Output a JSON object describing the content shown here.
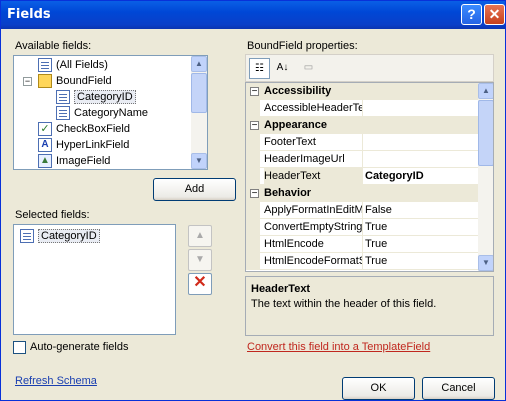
{
  "window": {
    "title": "Fields",
    "help_glyph": "?",
    "close_glyph": "✕"
  },
  "available": {
    "label": "Available fields:",
    "items": [
      {
        "label": "(All Fields)",
        "icon": "field-icon"
      },
      {
        "label": "BoundField",
        "icon": "folder-icon",
        "expander": "−"
      },
      {
        "label": "CategoryID",
        "icon": "field-icon"
      },
      {
        "label": "CategoryName",
        "icon": "field-icon"
      },
      {
        "label": "CheckBoxField",
        "icon": "checkbox-field-icon"
      },
      {
        "label": "HyperLinkField",
        "icon": "hyperlink-field-icon"
      },
      {
        "label": "ImageField",
        "icon": "image-field-icon"
      }
    ],
    "add_label": "Add"
  },
  "selected": {
    "label": "Selected fields:",
    "items": [
      {
        "label": "CategoryID",
        "icon": "field-icon"
      }
    ],
    "move_up_icon": "arrow-up-icon",
    "move_down_icon": "arrow-down-icon",
    "delete_icon": "delete-icon"
  },
  "autogen": {
    "label": "Auto-generate fields",
    "checked": false
  },
  "refresh_label": "Refresh Schema",
  "properties": {
    "label": "BoundField properties:",
    "rows": [
      {
        "type": "category",
        "name": "Accessibility"
      },
      {
        "type": "prop",
        "name": "AccessibleHeaderTe",
        "value": ""
      },
      {
        "type": "category",
        "name": "Appearance"
      },
      {
        "type": "prop",
        "name": "FooterText",
        "value": ""
      },
      {
        "type": "prop",
        "name": "HeaderImageUrl",
        "value": ""
      },
      {
        "type": "prop",
        "name": "HeaderText",
        "value": "CategoryID",
        "selected": true
      },
      {
        "type": "category",
        "name": "Behavior"
      },
      {
        "type": "prop",
        "name": "ApplyFormatInEditM",
        "value": "False"
      },
      {
        "type": "prop",
        "name": "ConvertEmptyString",
        "value": "True"
      },
      {
        "type": "prop",
        "name": "HtmlEncode",
        "value": "True"
      },
      {
        "type": "prop",
        "name": "HtmlEncodeFormatS",
        "value": "True"
      }
    ],
    "description_title": "HeaderText",
    "description_text": "The text within the header of this field."
  },
  "convert_link": "Convert this field into a TemplateField",
  "ok_label": "OK",
  "cancel_label": "Cancel"
}
